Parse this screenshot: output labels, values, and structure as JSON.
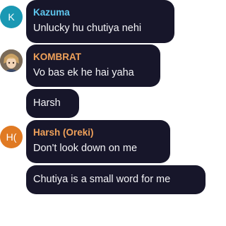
{
  "colors": {
    "bubble_background": "#17162a",
    "message_text": "#f3f3f6",
    "kazuma_name": "#5fc8f0",
    "kombrat_name": "#f0a15a",
    "harsh_name": "#f0a15a",
    "kazuma_avatar": "#1a98b3",
    "harsh_avatar": "#e07a23"
  },
  "messages": [
    {
      "sender": "Kazuma",
      "avatar": {
        "type": "initial",
        "text": "K"
      },
      "text": "Unlucky hu chutiya nehi"
    },
    {
      "sender": "KOMBRAT",
      "avatar": {
        "type": "image",
        "icon": "anime-character-avatar"
      },
      "text": "Vo bas ek he hai yaha"
    },
    {
      "sender": "",
      "text": "Harsh"
    },
    {
      "sender": "Harsh (Oreki)",
      "avatar": {
        "type": "initial",
        "text": "H("
      },
      "text": "Don't look down on me"
    },
    {
      "sender": "",
      "text": "Chutiya is a small word for me"
    }
  ]
}
